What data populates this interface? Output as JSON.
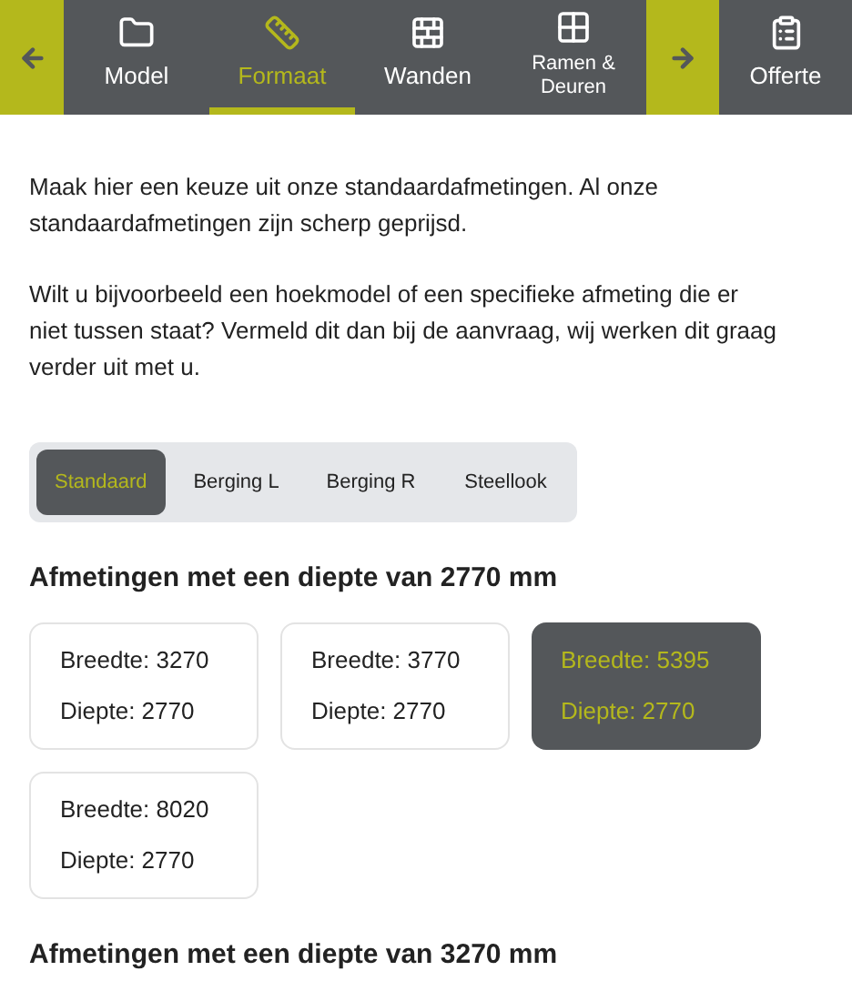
{
  "nav": {
    "steps": [
      {
        "label": "Model",
        "kind": "folder",
        "selected": false
      },
      {
        "label": "Formaat",
        "kind": "ruler",
        "selected": true
      },
      {
        "label": "Wanden",
        "kind": "bricks",
        "selected": false
      },
      {
        "label": "Ramen & Deuren",
        "kind": "window",
        "selected": false
      }
    ],
    "final_step": {
      "label": "Offerte",
      "kind": "clipboard"
    }
  },
  "intro": [
    "Maak hier een keuze uit onze standaardafmetingen. Al onze standaardafmetingen zijn scherp geprijsd.",
    "Wilt u bijvoorbeeld een hoekmodel of een specifieke afmeting die er niet tussen staat? Vermeld dit dan bij de aanvraag, wij werken dit graag verder uit met u."
  ],
  "types": [
    {
      "label": "Standaard",
      "selected": true
    },
    {
      "label": "Berging L",
      "selected": false
    },
    {
      "label": "Berging R",
      "selected": false
    },
    {
      "label": "Steellook",
      "selected": false
    }
  ],
  "groups": [
    {
      "title": "Afmetingen met een diepte van 2770 mm",
      "options": [
        {
          "width": "Breedte: 3270",
          "depth": "Diepte: 2770",
          "selected": false
        },
        {
          "width": "Breedte: 3770",
          "depth": "Diepte: 2770",
          "selected": false
        },
        {
          "width": "Breedte: 5395",
          "depth": "Diepte: 2770",
          "selected": true
        },
        {
          "width": "Breedte: 8020",
          "depth": "Diepte: 2770",
          "selected": false
        }
      ]
    },
    {
      "title": "Afmetingen met een diepte van 3270 mm"
    }
  ]
}
